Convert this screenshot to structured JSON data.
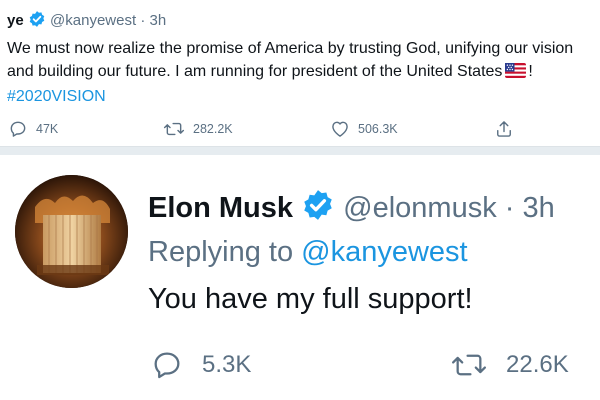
{
  "tweet1": {
    "name": "ye",
    "handle": "@kanyewest",
    "time": "· 3h",
    "text_part1": "We must now realize the promise of America by trusting God, unifying our vision and building our future. I am running for president of the United States",
    "text_after_flag": "! ",
    "hashtag": "#2020VISION",
    "replies": "47K",
    "retweets": "282.2K",
    "likes": "506.3K"
  },
  "tweet2": {
    "name": "Elon Musk",
    "handle": "@elonmusk",
    "time": "· 3h",
    "replying_prefix": "Replying to",
    "replying_to": "@kanyewest",
    "text": "You have my full support!",
    "replies": "5.3K",
    "retweets": "22.6K"
  },
  "colors": {
    "accent": "#1b95e0",
    "verified": "#1da1f2",
    "muted": "#5b7083",
    "divider": "#e6ecf0"
  },
  "icons": [
    "verified-badge-icon",
    "reply-icon",
    "retweet-icon",
    "like-icon",
    "share-icon",
    "us-flag-icon"
  ]
}
